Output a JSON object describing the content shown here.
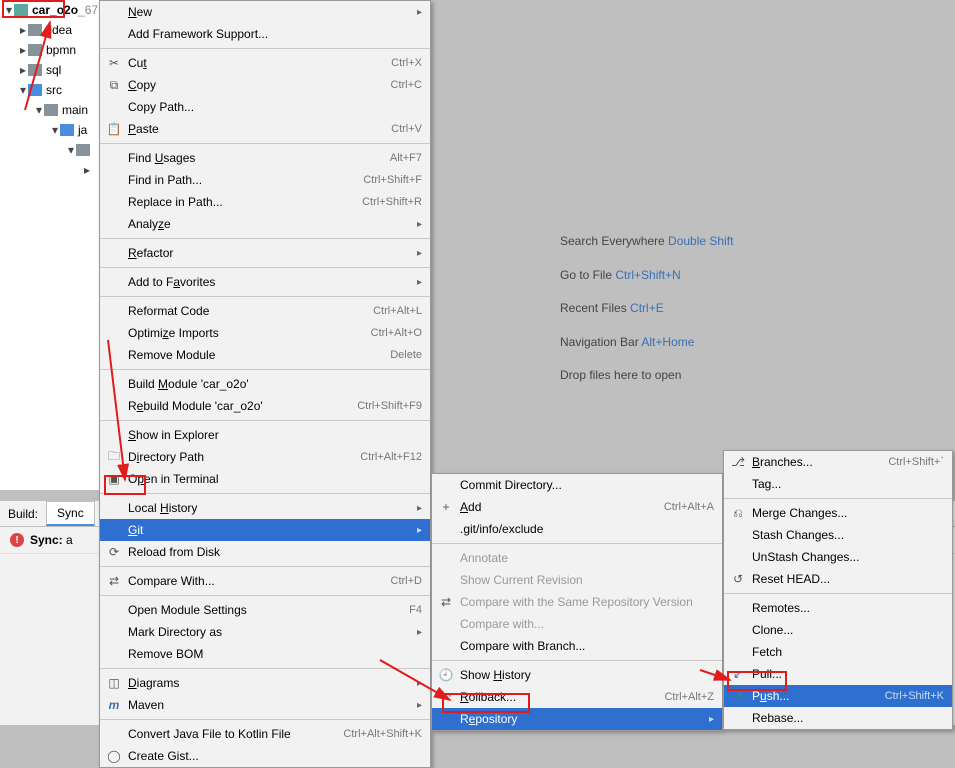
{
  "tree": {
    "root": "car_o2o",
    "rootSuffix": "_67",
    "items": [
      ".idea",
      "bpmn",
      "sql",
      "src",
      "main",
      "ja"
    ]
  },
  "hints": {
    "l1a": "Search Everywhere ",
    "l1b": "Double Shift",
    "l2a": "Go to File ",
    "l2b": "Ctrl+Shift+N",
    "l3a": "Recent Files ",
    "l3b": "Ctrl+E",
    "l4a": "Navigation Bar ",
    "l4b": "Alt+Home",
    "l5": "Drop files here to open"
  },
  "bottom": {
    "buildLabel": "Build:",
    "tab": "Sync",
    "syncPrefix": "Sync:",
    "syncText": "a"
  },
  "m1": {
    "new": "New",
    "addfw": "Add Framework Support...",
    "cut": "Cut",
    "cut_sc": "Ctrl+X",
    "copy": "Copy",
    "copy_sc": "Ctrl+C",
    "copypath": "Copy Path...",
    "paste": "Paste",
    "paste_sc": "Ctrl+V",
    "findusages": "Find Usages",
    "findusages_sc": "Alt+F7",
    "findinpath": "Find in Path...",
    "findinpath_sc": "Ctrl+Shift+F",
    "replaceinpath": "Replace in Path...",
    "replaceinpath_sc": "Ctrl+Shift+R",
    "analyze": "Analyze",
    "refactor": "Refactor",
    "addfav": "Add to Favorites",
    "reformat": "Reformat Code",
    "reformat_sc": "Ctrl+Alt+L",
    "optimize": "Optimize Imports",
    "optimize_sc": "Ctrl+Alt+O",
    "removemod": "Remove Module",
    "removemod_sc": "Delete",
    "buildmod": "Build Module 'car_o2o'",
    "rebuildmod": "Rebuild Module 'car_o2o'",
    "rebuildmod_sc": "Ctrl+Shift+F9",
    "showexp": "Show in Explorer",
    "dirpath": "Directory Path",
    "dirpath_sc": "Ctrl+Alt+F12",
    "openterm": "Open in Terminal",
    "localhist": "Local History",
    "git": "Git",
    "reload": "Reload from Disk",
    "compare": "Compare With...",
    "compare_sc": "Ctrl+D",
    "openmodset": "Open Module Settings",
    "openmodset_sc": "F4",
    "markdir": "Mark Directory as",
    "removebom": "Remove BOM",
    "diagrams": "Diagrams",
    "maven": "Maven",
    "convertk": "Convert Java File to Kotlin File",
    "convertk_sc": "Ctrl+Alt+Shift+K",
    "creategist": "Create Gist..."
  },
  "m2": {
    "commit": "Commit Directory...",
    "add": "Add",
    "add_sc": "Ctrl+Alt+A",
    "gitinfo": ".git/info/exclude",
    "annotate": "Annotate",
    "showcur": "Show Current Revision",
    "comparesame": "Compare with the Same Repository Version",
    "comparew": "Compare with...",
    "comparebranch": "Compare with Branch...",
    "showhist": "Show History",
    "rollback": "Rollback...",
    "rollback_sc": "Ctrl+Alt+Z",
    "repository": "Repository"
  },
  "m3": {
    "branches": "Branches...",
    "branches_sc": "Ctrl+Shift+`",
    "tag": "Tag...",
    "merge": "Merge Changes...",
    "stash": "Stash Changes...",
    "unstash": "UnStash Changes...",
    "reset": "Reset HEAD...",
    "remotes": "Remotes...",
    "clone": "Clone...",
    "fetch": "Fetch",
    "pull": "Pull...",
    "push": "Push...",
    "push_sc": "Ctrl+Shift+K",
    "rebase": "Rebase..."
  }
}
